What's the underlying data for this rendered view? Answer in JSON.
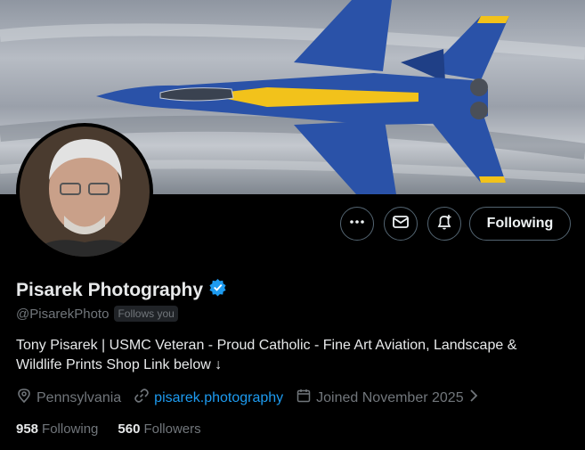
{
  "profile": {
    "name": "Pisarek Photography",
    "handle": "@PisarekPhoto",
    "follows_you_badge": "Follows you",
    "bio_line1": "Tony Pisarek | USMC Veteran - Proud Catholic - Fine Art Aviation, Landscape &",
    "bio_line2": "Wildlife Prints Shop Link below ↓",
    "location": "Pennsylvania",
    "website": "pisarek.photography",
    "joined": "Joined November 2025",
    "following_count": "958",
    "following_label": "Following",
    "followers_count": "560",
    "followers_label": "Followers"
  },
  "actions": {
    "more_icon": "more-dots-icon",
    "message_icon": "envelope-icon",
    "notify_icon": "bell-plus-icon",
    "follow_button_label": "Following"
  },
  "colors": {
    "background": "#000000",
    "link": "#1d9bf0",
    "verified": "#1d9bf0",
    "muted_text": "#71767b",
    "jet_blue": "#2a52a8",
    "jet_yellow": "#f2c21b"
  }
}
